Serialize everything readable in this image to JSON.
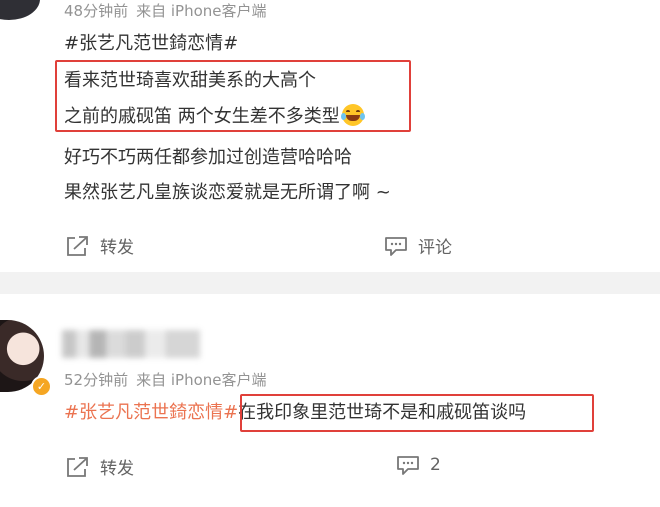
{
  "post1": {
    "time": "48分钟前",
    "source": "来自 iPhone客户端",
    "hashtag": "#张艺凡范世錡恋情#",
    "lines": [
      "看来范世琦喜欢甜美系的大高个",
      "之前的戚砚笛 两个女生差不多类型",
      "好巧不巧两任都参加过创造营哈哈哈",
      "果然张艺凡皇族谈恋爱就是无所谓了啊 ~"
    ],
    "emoji": "laugh-cry-emoji",
    "repost_label": "转发",
    "comment_label": "评论"
  },
  "post2": {
    "time": "52分钟前",
    "source": "来自 iPhone客户端",
    "hashtag": "#张艺凡范世錡恋情#",
    "text": "在我印象里范世琦不是和戚砚笛谈吗",
    "repost_label": "转发",
    "comment_count": "2"
  },
  "colors": {
    "hashtag": "#eb7350",
    "highlight_box": "#e0403a",
    "meta": "#939393",
    "verified_badge": "#f5a623"
  }
}
